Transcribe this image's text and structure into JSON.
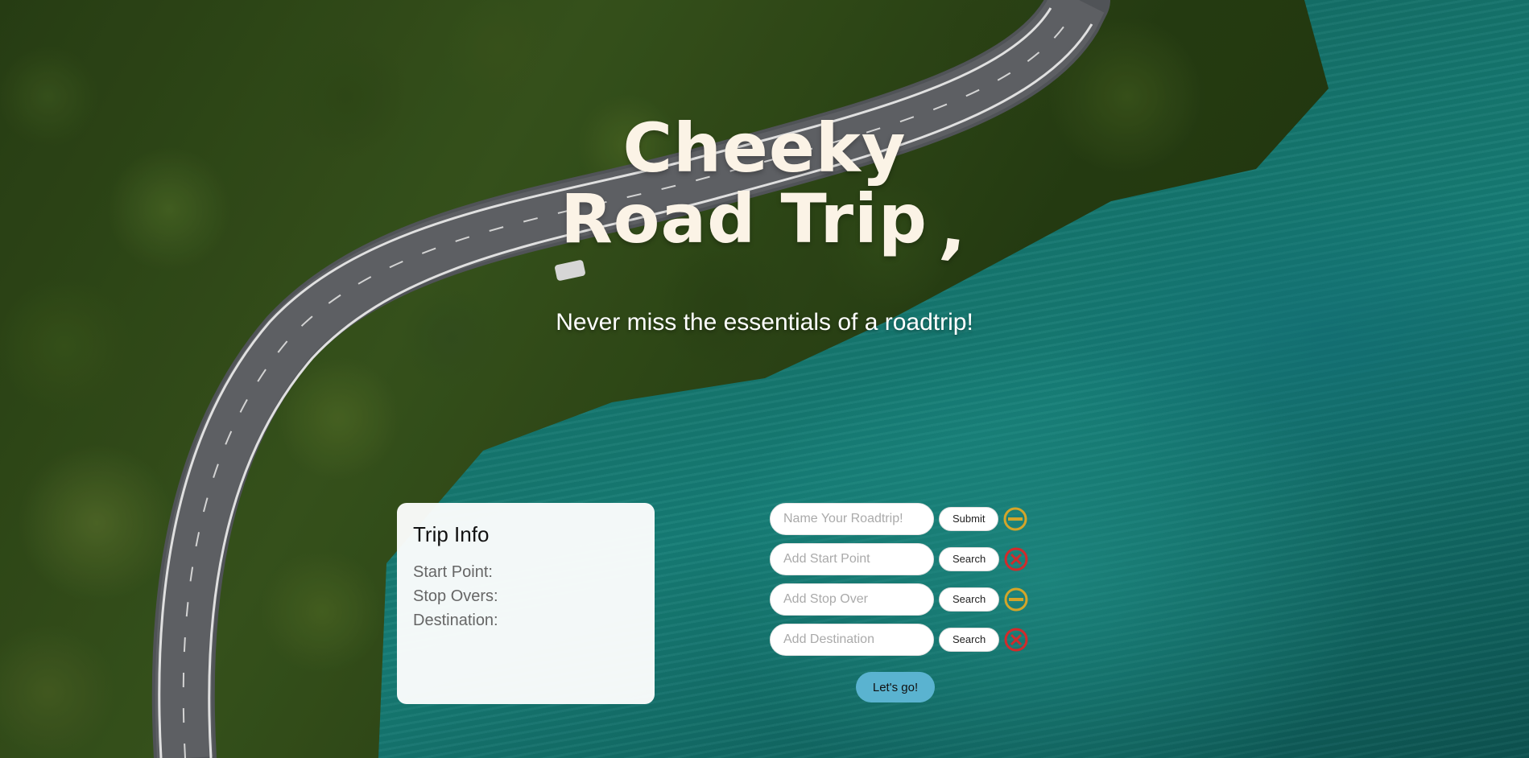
{
  "hero": {
    "title_line1": "Cheeky",
    "title_line2": "Road Trip",
    "title_mark": ",",
    "tagline": "Never miss the essentials of a roadtrip!"
  },
  "trip_info": {
    "title": "Trip Info",
    "start_label": "Start Point:",
    "stopovers_label": "Stop Overs:",
    "destination_label": "Destination:"
  },
  "form": {
    "name": {
      "placeholder": "Name Your Roadtrip!",
      "value": "",
      "button": "Submit",
      "icon": "minus-circle-icon"
    },
    "start": {
      "placeholder": "Add Start Point",
      "value": "",
      "button": "Search",
      "icon": "x-circle-icon"
    },
    "stop": {
      "placeholder": "Add Stop Over",
      "value": "",
      "button": "Search",
      "icon": "minus-circle-icon"
    },
    "destination": {
      "placeholder": "Add Destination",
      "value": "",
      "button": "Search",
      "icon": "x-circle-icon"
    },
    "go_button": "Let's go!"
  },
  "colors": {
    "title": "#fbf3e6",
    "go_button": "#5ab3d0",
    "minus_icon": "#d4a52a",
    "x_icon": "#d12b2b"
  }
}
